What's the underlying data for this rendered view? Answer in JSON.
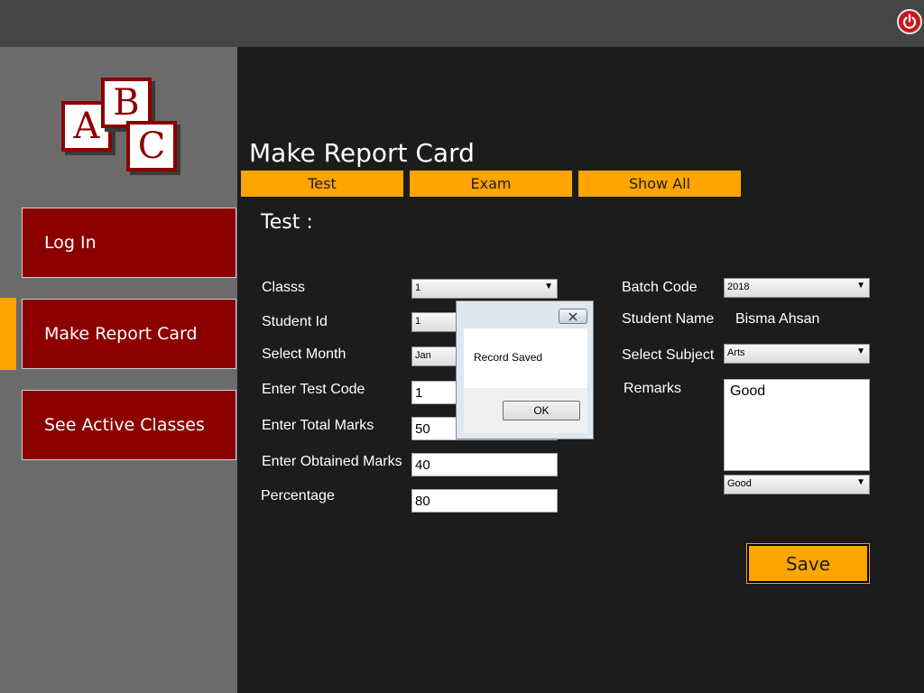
{
  "app": {
    "logo_letters": [
      "A",
      "B",
      "C"
    ],
    "power_icon": "power-icon",
    "colors": {
      "accent": "#ffa500",
      "nav": "#8b0000",
      "background": "#1c1c1c",
      "sidebar": "#6b6b6b",
      "topbar": "#454545"
    }
  },
  "sidebar": {
    "items": [
      {
        "label": "Log In"
      },
      {
        "label": "Make Report Card",
        "active": true
      },
      {
        "label": "See Active Classes"
      }
    ]
  },
  "main": {
    "title": "Make Report Card",
    "tabs": [
      {
        "label": "Test"
      },
      {
        "label": "Exam"
      },
      {
        "label": "Show All"
      }
    ],
    "section_title": "Test :"
  },
  "form": {
    "class_label": "Classs",
    "class_value": "1",
    "student_id_label": "Student Id",
    "student_id_value": "1",
    "month_label": "Select Month",
    "month_value": "Jan",
    "test_code_label": "Enter Test Code",
    "test_code_value": "1",
    "total_marks_label": "Enter Total Marks",
    "total_marks_value": "50",
    "obtained_marks_label": "Enter Obtained Marks",
    "obtained_marks_value": "40",
    "percentage_label": "Percentage",
    "percentage_value": "80",
    "batch_code_label": "Batch Code",
    "batch_code_value": "2018",
    "student_name_label": "Student Name",
    "student_name_value": "Bisma Ahsan",
    "subject_label": "Select Subject",
    "subject_value": "Arts",
    "remarks_label": "Remarks",
    "remarks_text": "Good",
    "remarks_select_value": "Good",
    "save_label": "Save"
  },
  "dialog": {
    "message": "Record Saved",
    "ok_label": "OK",
    "close_icon": "close-icon"
  }
}
